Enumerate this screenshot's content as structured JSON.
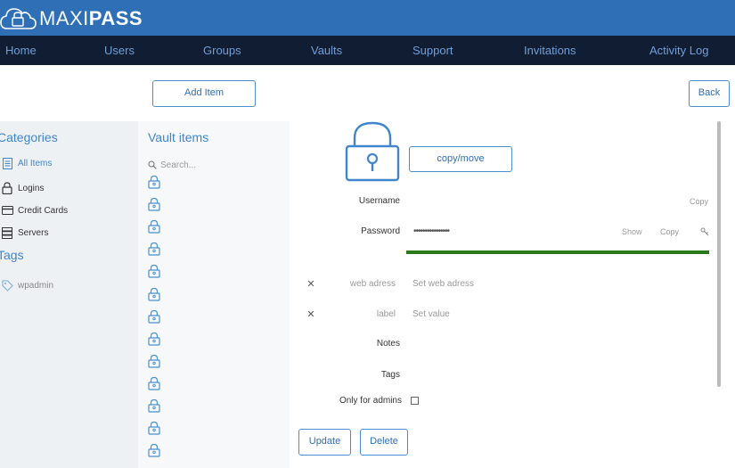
{
  "app": {
    "logo_part1": "MAXI",
    "logo_part2": "PASS"
  },
  "nav": {
    "items": [
      "Home",
      "Users",
      "Groups",
      "Vaults",
      "Support",
      "Invitations",
      "Activity Log"
    ]
  },
  "toolbar": {
    "add_item_label": "Add Item",
    "back_label": "Back"
  },
  "sidebar": {
    "categories_title": "Categories",
    "categories": [
      {
        "label": "All Items",
        "icon": "document-icon",
        "active": true
      },
      {
        "label": "Logins",
        "icon": "lock-icon",
        "active": false
      },
      {
        "label": "Credit Cards",
        "icon": "credit-card-icon",
        "active": false
      },
      {
        "label": "Servers",
        "icon": "server-icon",
        "active": false
      }
    ],
    "tags_title": "Tags",
    "tags": [
      {
        "label": "wpadmin",
        "icon": "tag-icon"
      }
    ]
  },
  "vault": {
    "title": "Vault items",
    "search_placeholder": "Search...",
    "item_count": 13
  },
  "detail": {
    "copy_move_label": "copy/move",
    "username_label": "Username",
    "username_copy": "Copy",
    "password_label": "Password",
    "password_value": "••••••••••••••••",
    "password_show": "Show",
    "password_copy": "Copy",
    "web_address_label": "web adress",
    "web_address_placeholder": "Set web adress",
    "custom_label_label": "label",
    "custom_label_placeholder": "Set value",
    "notes_label": "Notes",
    "tags_label": "Tags",
    "only_admins_label": "Only for admins",
    "only_admins_checked": false,
    "update_label": "Update",
    "delete_label": "Delete"
  },
  "colors": {
    "header_blue": "#2f6fb5",
    "nav_dark": "#111d33",
    "accent": "#3f86cc",
    "strength_green": "#2a7a1c"
  }
}
